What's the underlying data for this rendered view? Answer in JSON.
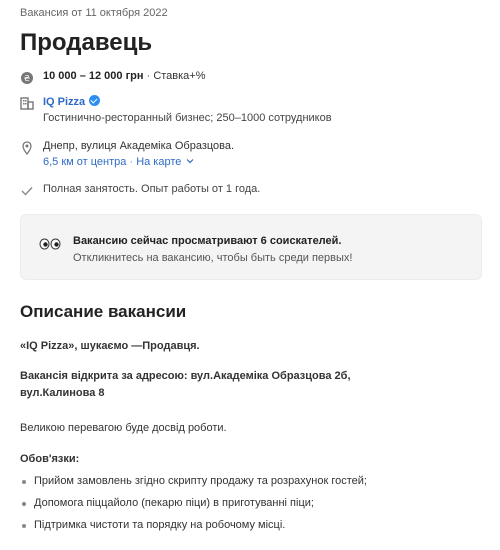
{
  "vacancy": {
    "date": "Вакансия от 11 октября 2022",
    "title": "Продавець",
    "salary": {
      "range": "10 000 – 12 000 грн",
      "separator": " · ",
      "extra": "Ставка+%"
    },
    "company": {
      "name": "IQ Pizza",
      "description": "Гостинично-ресторанный бизнес; 250–1000 сотрудников"
    },
    "location": {
      "address": "Днепр, вулиця Академіка Образцова.",
      "distance": "6,5 км от центра",
      "separator": " · ",
      "map_link": "На карте"
    },
    "employment": "Полная занятость. Опыт работы от 1 года."
  },
  "notice": {
    "title": "Вакансию сейчас просматривают 6 соискателей.",
    "subtitle": "Откликнитесь на вакансию, чтобы быть среди первых!"
  },
  "description": {
    "heading": "Описание вакансии",
    "intro": "«IQ Pizza», шукаємо —Продавця.",
    "address_line": "Вакансія відкрита за адресою: вул.Академіка Образцова 2б, вул.Калинова 8",
    "advantage": "Великою перевагою буде досвід роботи.",
    "duties_heading": "Обов'язки:",
    "duties": [
      "Прийом замовлень згідно скрипту продажу та розрахунок гостей;",
      "Допомога піццайоло (пекарю піци) в приготуванні піци;",
      "Підтримка чистоти та порядку на робочому місці."
    ]
  },
  "colors": {
    "link": "#2e6bc6",
    "verified_badge": "#2e8ef0",
    "notice_bg": "#f4f4f4"
  },
  "icons": {
    "salary": "coin-icon",
    "company": "building-icon",
    "location": "map-pin-icon",
    "employment": "check-icon",
    "notice": "eyes-icon"
  }
}
